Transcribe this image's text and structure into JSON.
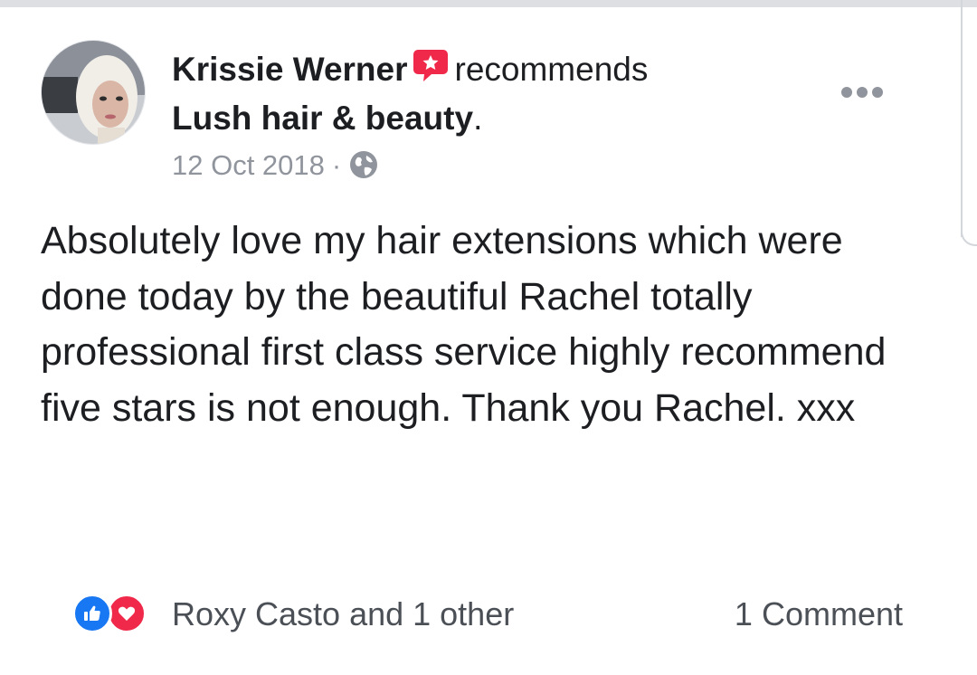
{
  "post": {
    "author": "Krissie Werner",
    "verb": "recommends",
    "page": "Lush hair & beauty",
    "page_suffix": ".",
    "date": "12 Oct 2018",
    "separator": "·",
    "privacy_icon": "globe-icon",
    "recommend_icon": "recommend-star-icon",
    "more_icon": "more-options-icon",
    "text": "Absolutely love my hair extensions which were done today by the beautiful Rachel totally professional first class service highly recommend five stars is not enough. Thank you Rachel. xxx"
  },
  "footer": {
    "reaction_icons": [
      "like-icon",
      "love-icon"
    ],
    "reactions_text": "Roxy Casto and 1 other",
    "comments_text": "1 Comment"
  },
  "colors": {
    "like": "#1877f2",
    "love": "#f0284a",
    "recommend": "#f0284a",
    "meta": "#90949c"
  }
}
